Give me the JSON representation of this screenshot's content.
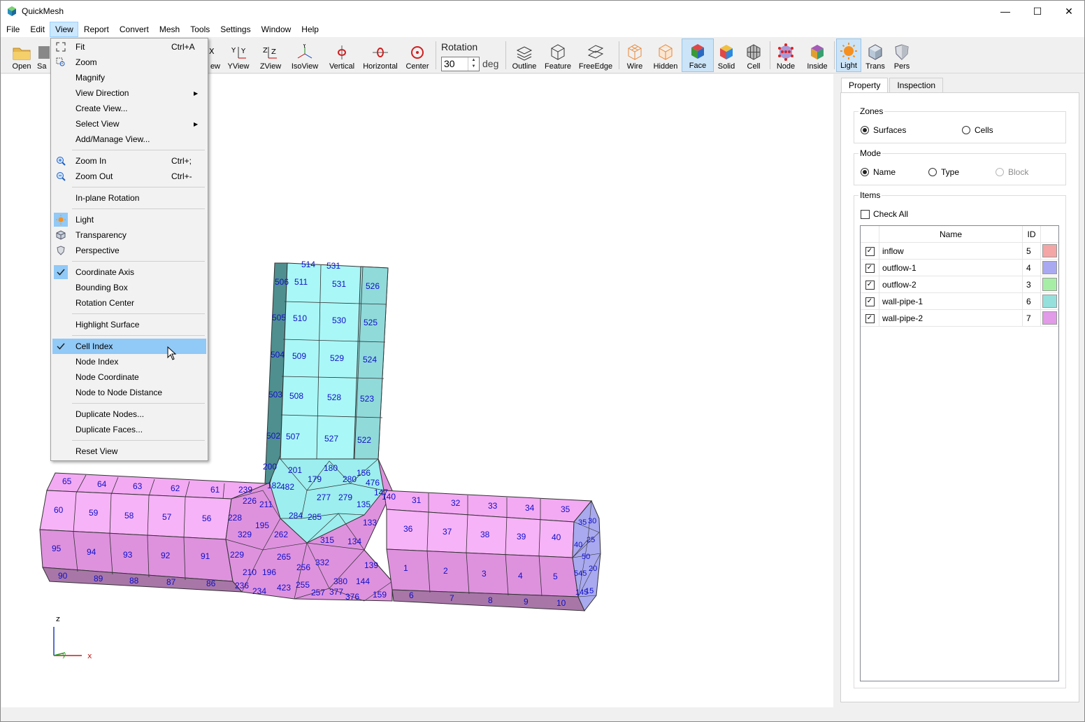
{
  "app": {
    "title": "QuickMesh"
  },
  "menubar": [
    "File",
    "Edit",
    "View",
    "Report",
    "Convert",
    "Mesh",
    "Tools",
    "Settings",
    "Window",
    "Help"
  ],
  "toolbar": {
    "open": "Open",
    "save_partial": "Sa",
    "xview_partial": "ew",
    "yview": "YView",
    "zview": "ZView",
    "isoview": "IsoView",
    "vertical": "Vertical",
    "horizontal": "Horizontal",
    "center": "Center",
    "rotation_label": "Rotation",
    "rotation_value": "30",
    "rotation_unit": "deg",
    "outline": "Outline",
    "feature": "Feature",
    "freeedge": "FreeEdge",
    "wire": "Wire",
    "hidden": "Hidden",
    "face": "Face",
    "solid": "Solid",
    "cell": "Cell",
    "node": "Node",
    "inside": "Inside",
    "light": "Light",
    "trans": "Trans",
    "pers": "Pers"
  },
  "view_menu": {
    "fit": "Fit",
    "fit_sc": "Ctrl+A",
    "zoom": "Zoom",
    "magnify": "Magnify",
    "view_direction": "View Direction",
    "create_view": "Create View...",
    "select_view": "Select View",
    "add_manage_view": "Add/Manage View...",
    "zoom_in": "Zoom In",
    "zoom_in_sc": "Ctrl+;",
    "zoom_out": "Zoom Out",
    "zoom_out_sc": "Ctrl+-",
    "inplane_rotation": "In-plane Rotation",
    "light": "Light",
    "transparency": "Transparency",
    "perspective": "Perspective",
    "coordinate_axis": "Coordinate Axis",
    "bounding_box": "Bounding Box",
    "rotation_center": "Rotation Center",
    "highlight_surface": "Highlight Surface",
    "cell_index": "Cell Index",
    "node_index": "Node Index",
    "node_coordinate": "Node Coordinate",
    "node_to_node_distance": "Node to Node Distance",
    "duplicate_nodes": "Duplicate Nodes...",
    "duplicate_faces": "Duplicate Faces...",
    "reset_view": "Reset View"
  },
  "panel": {
    "tabs": [
      "Property",
      "Inspection"
    ],
    "zones_title": "Zones",
    "zones_surfaces": "Surfaces",
    "zones_cells": "Cells",
    "mode_title": "Mode",
    "mode_name": "Name",
    "mode_type": "Type",
    "mode_block": "Block",
    "items_title": "Items",
    "check_all": "Check All",
    "col_name": "Name",
    "col_id": "ID",
    "rows": [
      {
        "name": "inflow",
        "id": "5",
        "color": "#f4a5a5"
      },
      {
        "name": "outflow-1",
        "id": "4",
        "color": "#a9a9f2"
      },
      {
        "name": "outflow-2",
        "id": "3",
        "color": "#a6eea6"
      },
      {
        "name": "wall-pipe-1",
        "id": "6",
        "color": "#95e0dd"
      },
      {
        "name": "wall-pipe-2",
        "id": "7",
        "color": "#e29be8"
      }
    ]
  },
  "axis": {
    "z": "z",
    "x": "x",
    "y": "y"
  },
  "mesh_labels": {
    "top_pipe": [
      "514",
      "531",
      "506",
      "511",
      "531",
      "526",
      "505",
      "510",
      "530",
      "525",
      "504",
      "509",
      "529",
      "524",
      "503",
      "508",
      "528",
      "523",
      "502",
      "507",
      "527",
      "522",
      "200",
      "201",
      "180",
      "156",
      "179",
      "280",
      "476",
      "277",
      "279",
      "147",
      "140",
      "135",
      "284",
      "285",
      "133",
      "182",
      "482",
      "211",
      "226",
      "239"
    ],
    "left_pipe": [
      "65",
      "64",
      "63",
      "62",
      "61",
      "60",
      "59",
      "58",
      "57",
      "56",
      "228",
      "195",
      "95",
      "94",
      "93",
      "92",
      "91",
      "329",
      "262",
      "229",
      "90",
      "89",
      "88",
      "87",
      "86",
      "210",
      "196",
      "236",
      "234",
      "265",
      "256",
      "332",
      "423",
      "255",
      "257",
      "377"
    ],
    "right_pipe": [
      "31",
      "32",
      "33",
      "34",
      "35",
      "36",
      "37",
      "38",
      "39",
      "40",
      "315",
      "134",
      "139",
      "1",
      "2",
      "3",
      "4",
      "5",
      "380",
      "144",
      "376",
      "159",
      "6",
      "7",
      "8",
      "9",
      "10"
    ],
    "end_cap": [
      "35",
      "30",
      "40",
      "25",
      "50",
      "20",
      "545",
      "15",
      "145"
    ]
  }
}
